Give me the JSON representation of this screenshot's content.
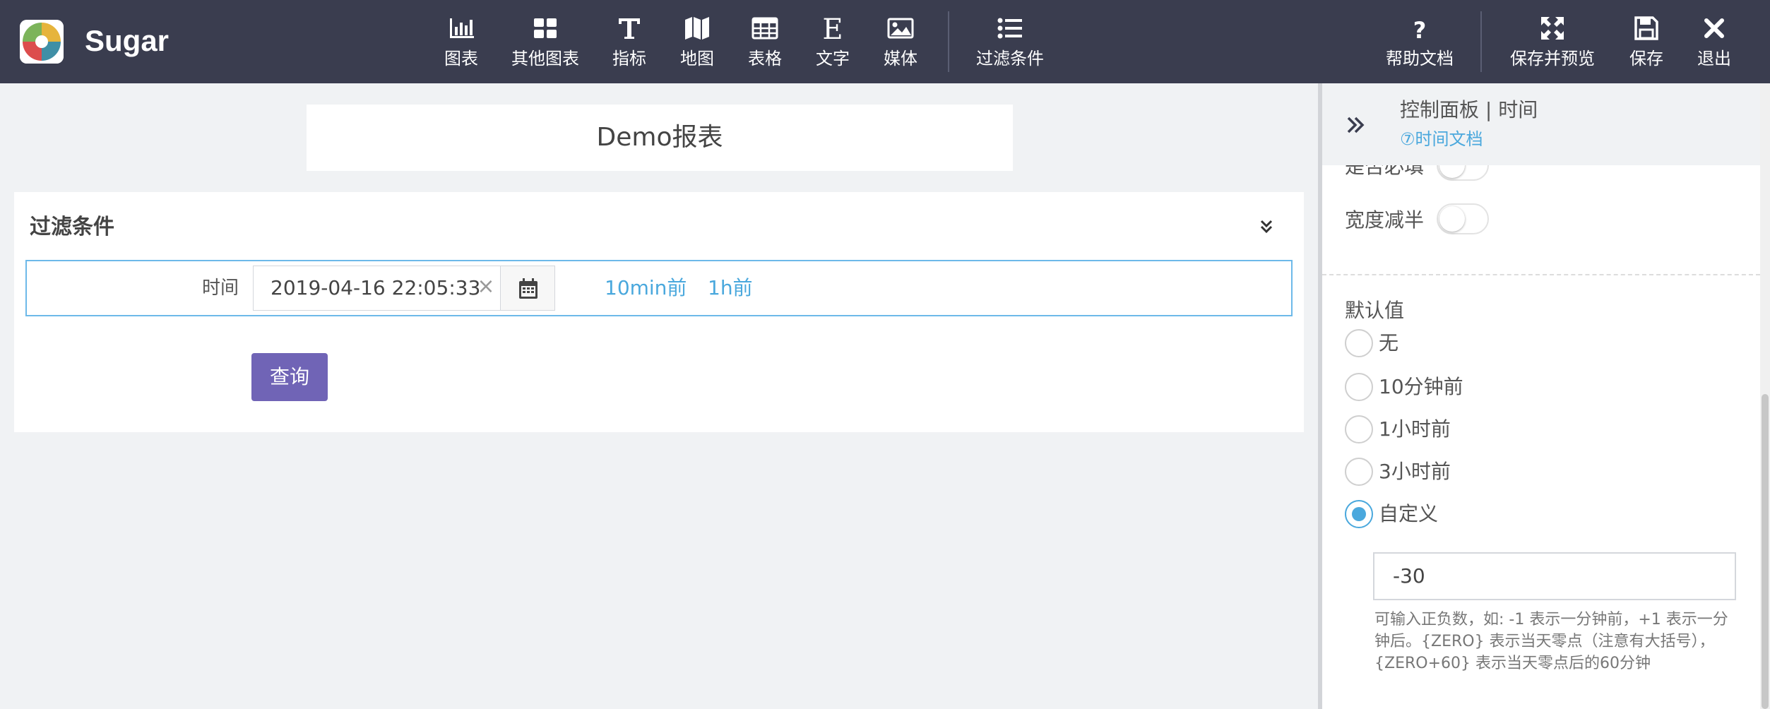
{
  "app": {
    "name": "Sugar"
  },
  "toolbar": {
    "items": [
      {
        "label": "图表",
        "icon": "bar-chart-icon"
      },
      {
        "label": "其他图表",
        "icon": "grid-icon"
      },
      {
        "label": "指标",
        "icon": "text-t-icon"
      },
      {
        "label": "地图",
        "icon": "map-icon"
      },
      {
        "label": "表格",
        "icon": "table-icon"
      },
      {
        "label": "文字",
        "icon": "text-e-icon"
      },
      {
        "label": "媒体",
        "icon": "image-icon"
      },
      {
        "label": "过滤条件",
        "icon": "list-icon"
      }
    ],
    "right_items": [
      {
        "label": "帮助文档",
        "icon": "question-icon"
      },
      {
        "label": "保存并预览",
        "icon": "expand-arrows-icon"
      },
      {
        "label": "保存",
        "icon": "floppy-icon"
      },
      {
        "label": "退出",
        "icon": "close-icon"
      }
    ]
  },
  "report": {
    "title": "Demo报表"
  },
  "filter": {
    "title": "过滤条件",
    "time_label": "时间",
    "date_value": "2019-04-16 22:05:33",
    "quick_links": [
      "10min前",
      "1h前"
    ],
    "query_label": "查询"
  },
  "panel": {
    "title": "控制面板 | 时间",
    "doc_link": "⑦时间文档",
    "required_label": "是否必填",
    "half_width_label": "宽度减半",
    "default_label": "默认值",
    "options": [
      "无",
      "10分钟前",
      "1小时前",
      "3小时前",
      "自定义"
    ],
    "selected_option": "自定义",
    "custom_value": "-30",
    "help_text": "可输入正负数，如: -1 表示一分钟前，+1 表示一分钟后。{ZERO} 表示当天零点（注意有大括号），{ZERO+60} 表示当天零点后的60分钟"
  },
  "colors": {
    "topbar": "#3a3d4f",
    "accent": "#4aa8dd",
    "query_button": "#7064b6",
    "background": "#f0f2f4"
  }
}
